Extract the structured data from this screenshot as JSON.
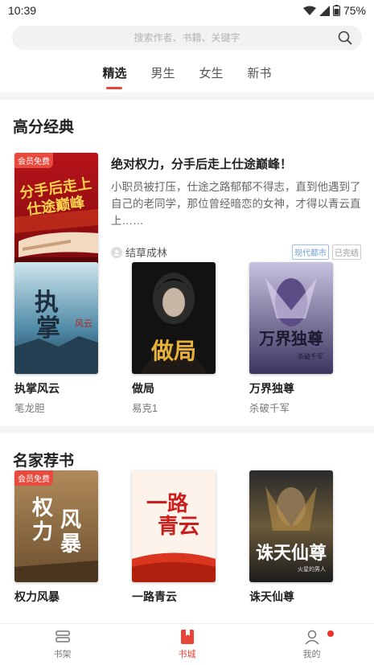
{
  "status": {
    "time": "10:39",
    "battery": "75%"
  },
  "search": {
    "placeholder": "搜索作者、书籍、关键字"
  },
  "tabs": [
    {
      "label": "精选",
      "active": true
    },
    {
      "label": "男生",
      "active": false
    },
    {
      "label": "女生",
      "active": false
    },
    {
      "label": "新书",
      "active": false
    }
  ],
  "sections": {
    "high_score": {
      "title": "高分经典",
      "feature": {
        "badge": "会员免费",
        "cover_text": "分手后走上仕途巅峰",
        "title": "绝对权力，分手后走上仕途巅峰！",
        "desc": "小职员被打压，仕途之路郁郁不得志，直到他遇到了自己的老同学，那位曾经暗恋的女神，才得以青云直上……",
        "author": "结草成林",
        "tags": [
          "现代都市",
          "已完结"
        ]
      },
      "books": [
        {
          "title": "执掌风云",
          "author": "笔龙胆",
          "cover_text": "执掌风云"
        },
        {
          "title": "做局",
          "author": "易克1",
          "cover_text": "做局"
        },
        {
          "title": "万界独尊",
          "author": "杀破千军",
          "cover_text": "万界独尊"
        }
      ]
    },
    "famous": {
      "title": "名家荐书",
      "books": [
        {
          "title": "权力风暴",
          "badge": "会员免费",
          "cover_text": "权力风暴"
        },
        {
          "title": "一路青云",
          "cover_text": "一路青云"
        },
        {
          "title": "诛天仙尊",
          "cover_text": "诛天仙尊"
        }
      ]
    }
  },
  "tabbar": [
    {
      "label": "书架",
      "icon": "bookshelf-icon",
      "active": false
    },
    {
      "label": "书城",
      "icon": "bookstore-icon",
      "active": true
    },
    {
      "label": "我的",
      "icon": "profile-icon",
      "active": false
    }
  ],
  "colors": {
    "accent": "#e8443a",
    "tag_city": "#6f9fd8"
  }
}
